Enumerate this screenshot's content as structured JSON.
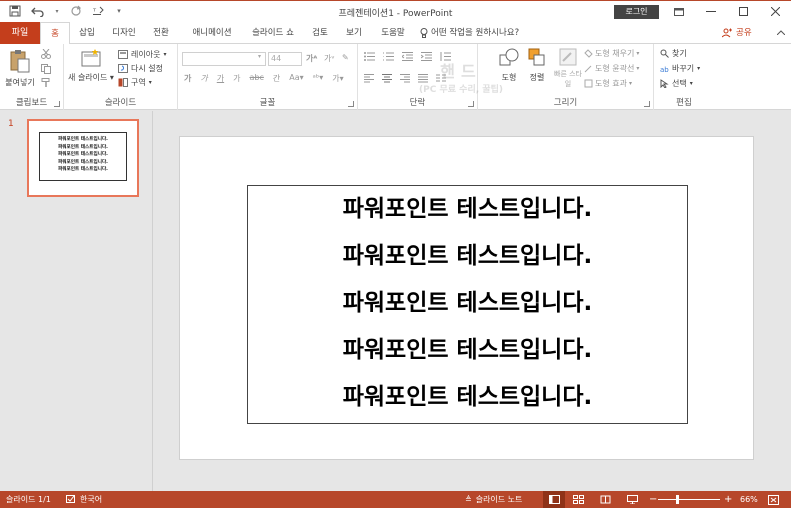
{
  "window": {
    "title": "프레젠테이션1  -  PowerPoint",
    "login_label": "로그인"
  },
  "tabs": {
    "file": "파일",
    "items": [
      "홈",
      "삽입",
      "디자인",
      "전환",
      "애니메이션",
      "슬라이드 쇼",
      "검토",
      "보기",
      "도움말"
    ],
    "tell_me": "어떤 작업을 원하시나요?",
    "share": "공유"
  },
  "ribbon": {
    "clipboard": {
      "paste": "붙여넣기",
      "label": "클립보드"
    },
    "slides": {
      "new_slide": "새 슬라이드",
      "layout": "레이아웃",
      "reset": "다시 설정",
      "section": "구역",
      "label": "슬라이드"
    },
    "font": {
      "font_size": "44",
      "label": "글꼴",
      "row2": [
        "가",
        "가",
        "가",
        "가",
        "abc",
        "간"
      ]
    },
    "paragraph": {
      "label": "단락"
    },
    "drawing": {
      "shapes": "도형",
      "arrange": "정렬",
      "quick_styles": "빠른 스타일",
      "fill": "도형 채우기",
      "outline": "도형 윤곽선",
      "effects": "도형 효과",
      "label": "그리기"
    },
    "editing": {
      "find": "찾기",
      "replace": "바꾸기",
      "select": "선택",
      "label": "편집"
    },
    "watermark": [
      "핸드",
      "(PC 무료 수리, 꿀팁)"
    ]
  },
  "thumbnails": [
    {
      "number": "1",
      "lines": [
        "파워포인트 테스트입니다.",
        "파워포인트 테스트입니다.",
        "파워포인트 테스트입니다.",
        "파워포인트 테스트입니다.",
        "파워포인트 테스트입니다."
      ]
    }
  ],
  "slide": {
    "lines": [
      "파워포인트 테스트입니다.",
      "파워포인트 테스트입니다.",
      "파워포인트 테스트입니다.",
      "파워포인트 테스트입니다.",
      "파워포인트 테스트입니다."
    ]
  },
  "status": {
    "slide_count": "슬라이드 1/1",
    "language": "한국어",
    "notes": "슬라이드 노트",
    "zoom": "66%"
  },
  "colors": {
    "accent": "#c43e1c",
    "statusbar": "#b7472a"
  }
}
